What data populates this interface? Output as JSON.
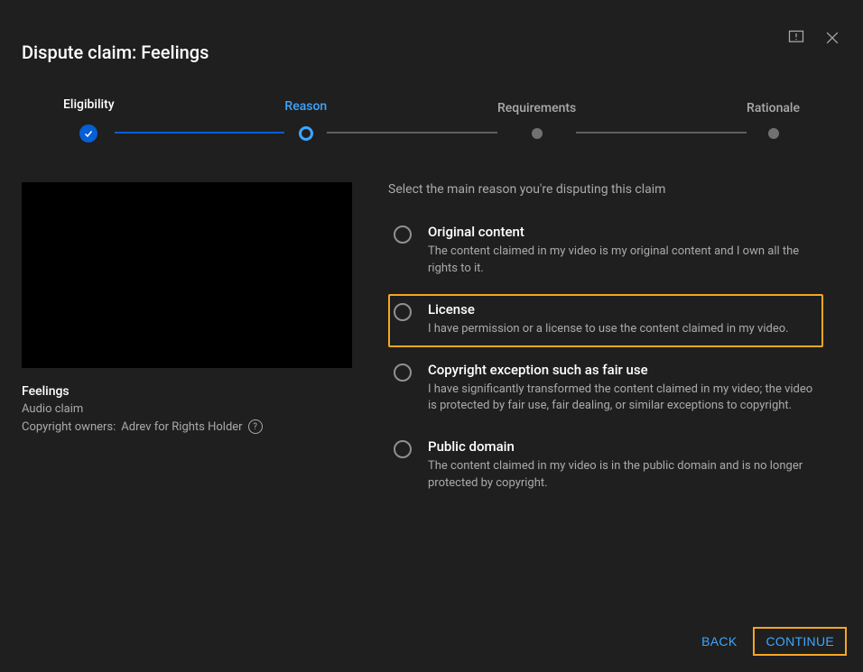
{
  "header": {
    "title": "Dispute claim: Feelings"
  },
  "stepper": {
    "steps": [
      {
        "label": "Eligibility",
        "state": "completed"
      },
      {
        "label": "Reason",
        "state": "active"
      },
      {
        "label": "Requirements",
        "state": "pending"
      },
      {
        "label": "Rationale",
        "state": "pending"
      }
    ]
  },
  "video": {
    "title": "Feelings",
    "claim_type": "Audio claim",
    "owners_prefix": "Copyright owners:",
    "owners": "Adrev for Rights Holder"
  },
  "reason": {
    "prompt": "Select the main reason you're disputing this claim",
    "options": [
      {
        "key": "original",
        "title": "Original content",
        "desc": "The content claimed in my video is my original content and I own all the rights to it.",
        "highlighted": false
      },
      {
        "key": "license",
        "title": "License",
        "desc": "I have permission or a license to use the content claimed in my video.",
        "highlighted": true
      },
      {
        "key": "fair-use",
        "title": "Copyright exception such as fair use",
        "desc": "I have significantly transformed the content claimed in my video; the video is protected by fair use, fair dealing, or similar exceptions to copyright.",
        "highlighted": false
      },
      {
        "key": "public-domain",
        "title": "Public domain",
        "desc": "The content claimed in my video is in the public domain and is no longer protected by copyright.",
        "highlighted": false
      }
    ]
  },
  "footer": {
    "back": "BACK",
    "continue": "CONTINUE"
  }
}
